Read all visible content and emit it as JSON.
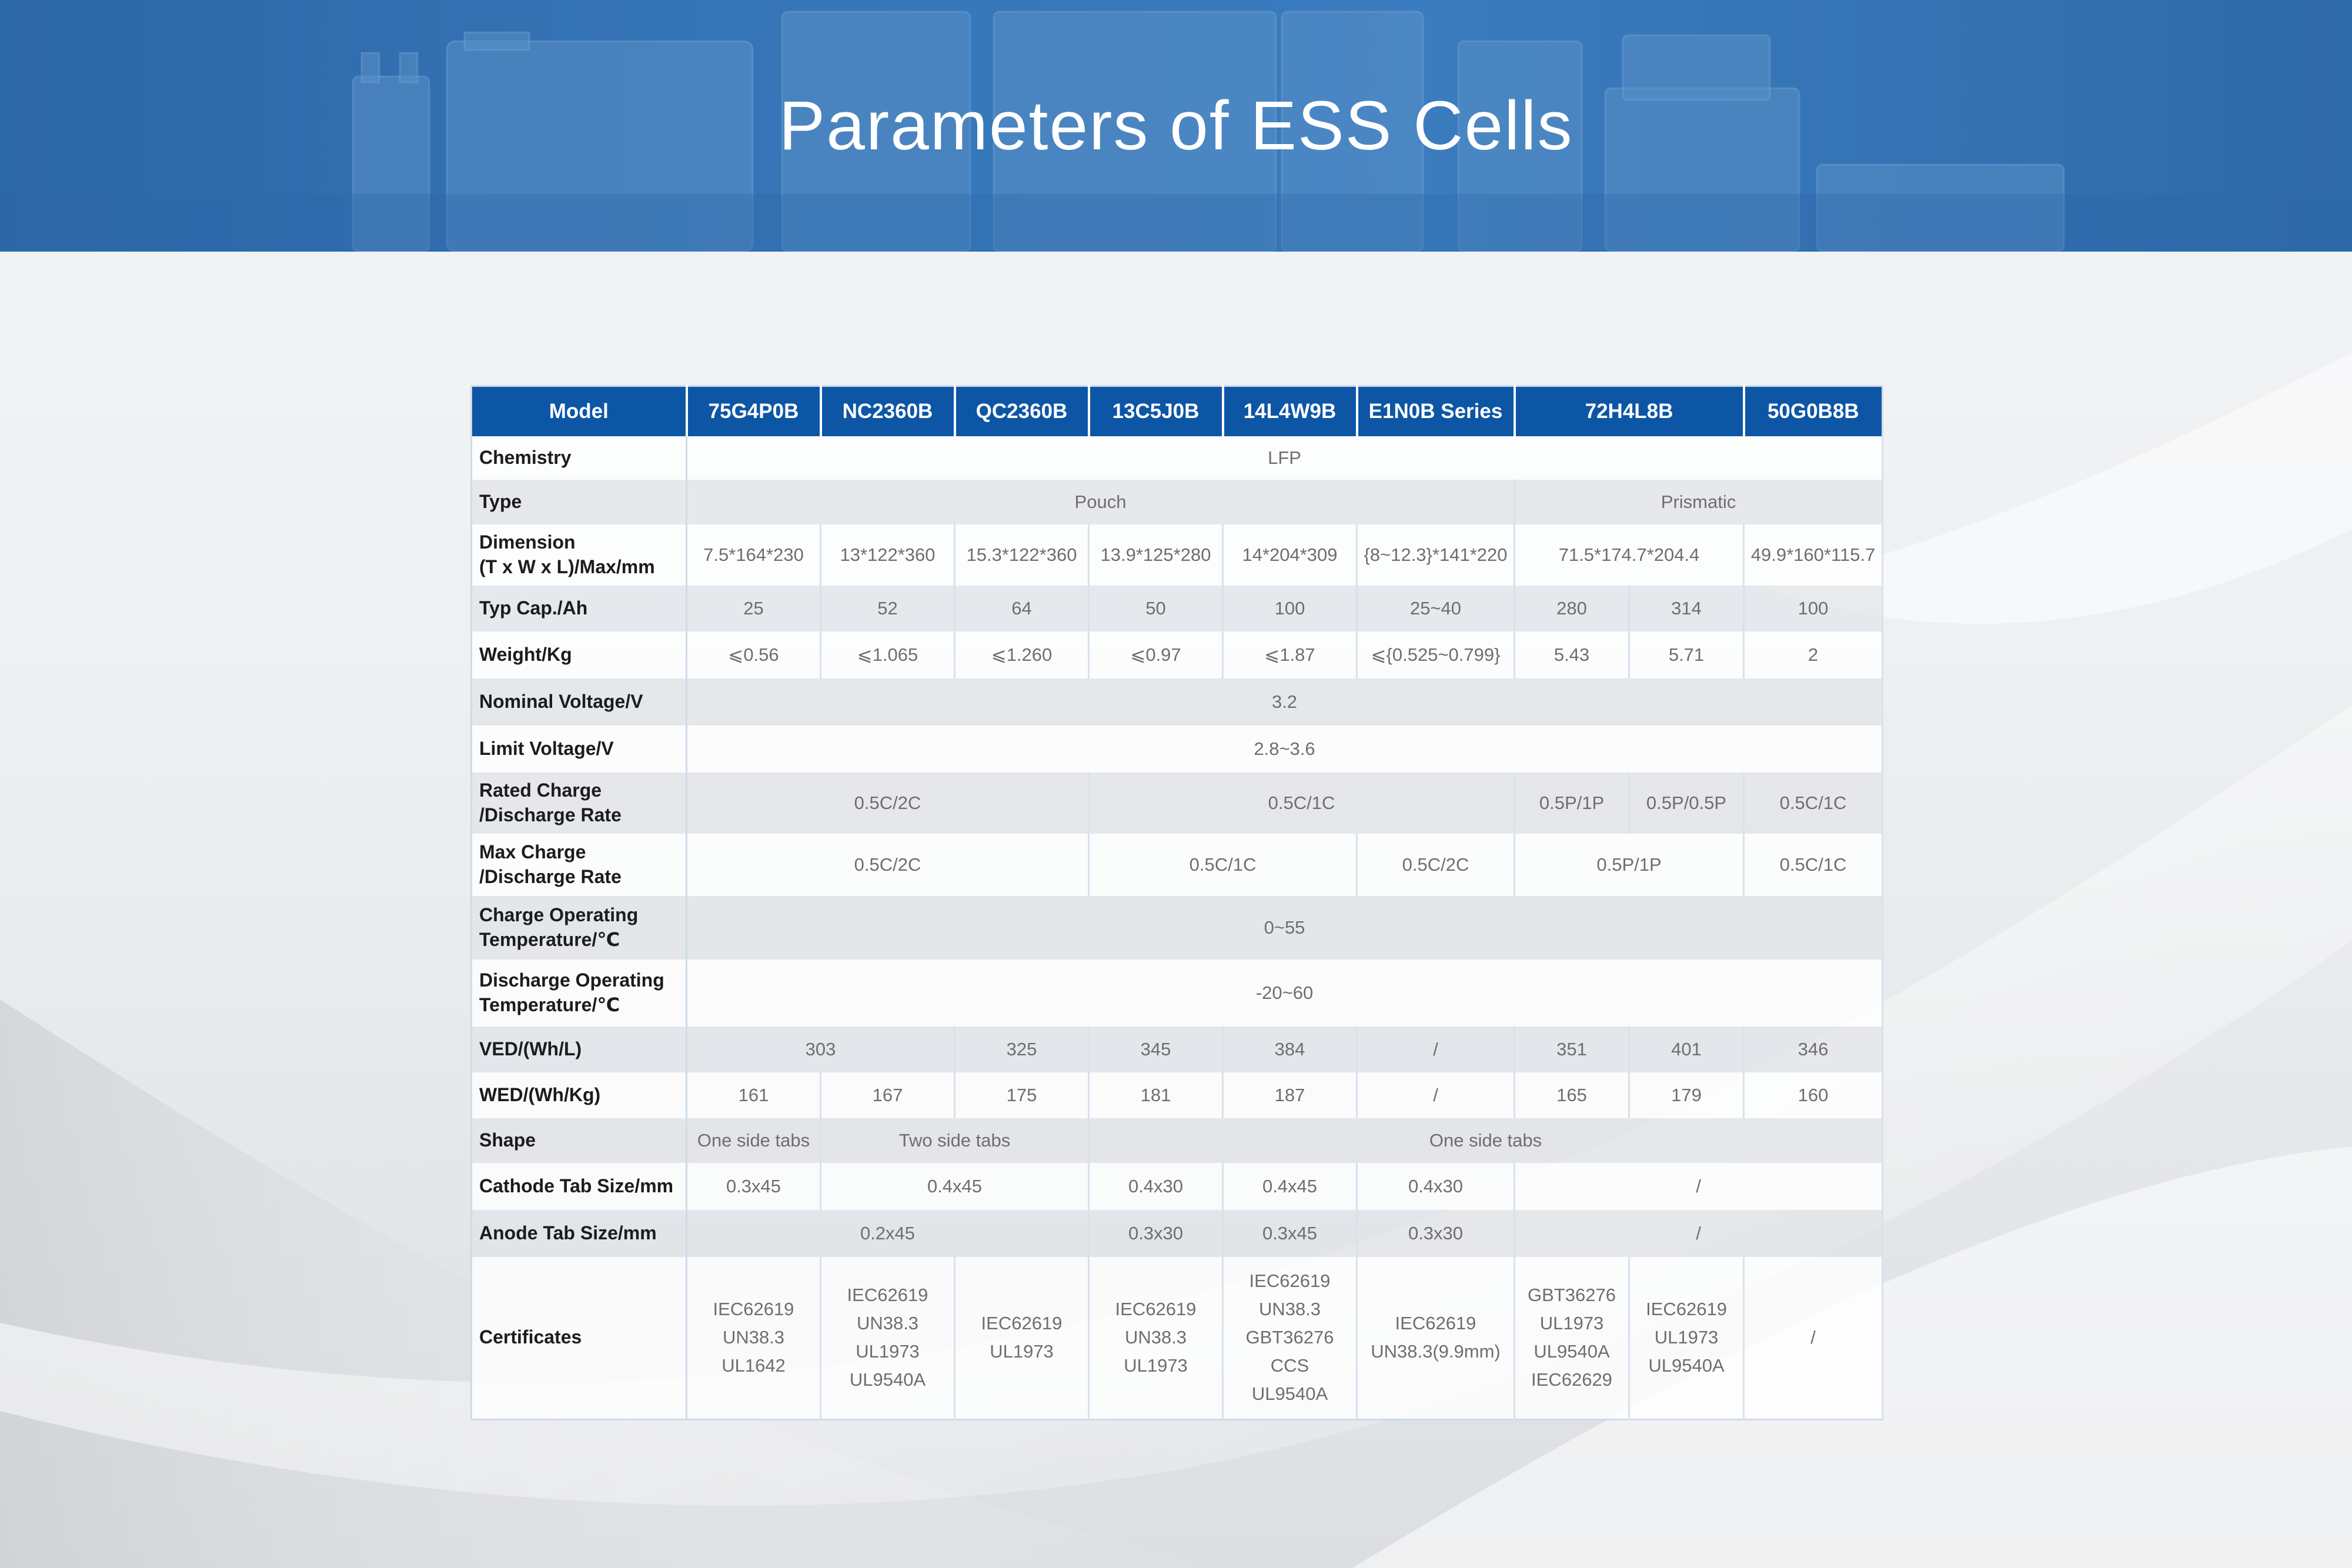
{
  "page": {
    "title": "Parameters of ESS Cells",
    "brand_color": "#0d56a5",
    "banner_color": "#3676b8"
  },
  "table": {
    "header": {
      "model": "Model",
      "m1": "75G4P0B",
      "m2": "NC2360B",
      "m3": "QC2360B",
      "m4": "13C5J0B",
      "m5": "14L4W9B",
      "m6": "E1N0B Series",
      "m7": "72H4L8B",
      "m8": "50G0B8B"
    },
    "chemistry": {
      "label": "Chemistry",
      "value": "LFP"
    },
    "type": {
      "label": "Type",
      "pouch": "Pouch",
      "prismatic": "Prismatic"
    },
    "dimension": {
      "label_1": "Dimension",
      "label_2": "(T x W x L)/Max/mm",
      "v1": "7.5*164*230",
      "v2": "13*122*360",
      "v3": "15.3*122*360",
      "v4": "13.9*125*280",
      "v5": "14*204*309",
      "v6": "{8~12.3}*141*220",
      "v7": "71.5*174.7*204.4",
      "v8": "49.9*160*115.7"
    },
    "capacity": {
      "label": "Typ Cap./Ah",
      "v1": "25",
      "v2": "52",
      "v3": "64",
      "v4": "50",
      "v5": "100",
      "v6": "25~40",
      "v7a": "280",
      "v7b": "314",
      "v8": "100"
    },
    "weight": {
      "label": "Weight/Kg",
      "v1": "⩽0.56",
      "v2": "⩽1.065",
      "v3": "⩽1.260",
      "v4": "⩽0.97",
      "v5": "⩽1.87",
      "v6": "⩽{0.525~0.799}",
      "v7a": "5.43",
      "v7b": "5.71",
      "v8": "2"
    },
    "nominal_voltage": {
      "label": "Nominal Voltage/V",
      "value": "3.2"
    },
    "limit_voltage": {
      "label": "Limit Voltage/V",
      "value": "2.8~3.6"
    },
    "rated_rate": {
      "label_1": "Rated Charge",
      "label_2": "/Discharge Rate",
      "a": "0.5C/2C",
      "b": "0.5C/1C",
      "c": "0.5P/1P",
      "d": "0.5P/0.5P",
      "e": "0.5C/1C"
    },
    "max_rate": {
      "label_1": "Max Charge",
      "label_2": "/Discharge Rate",
      "a": "0.5C/2C",
      "b": "0.5C/1C",
      "c": "0.5C/2C",
      "d": "0.5P/1P",
      "e": "0.5C/1C"
    },
    "charge_temp": {
      "label_1": "Charge Operating",
      "label_2": "Temperature/℃",
      "value": "0~55"
    },
    "discharge_temp": {
      "label_1": "Discharge Operating",
      "label_2": "Temperature/℃",
      "value": "-20~60"
    },
    "ved": {
      "label": "VED/(Wh/L)",
      "v12": "303",
      "v3": "325",
      "v4": "345",
      "v5": "384",
      "v6": "/",
      "v7a": "351",
      "v7b": "401",
      "v8": "346"
    },
    "wed": {
      "label": "WED/(Wh/Kg)",
      "v1": "161",
      "v2": "167",
      "v3": "175",
      "v4": "181",
      "v5": "187",
      "v6": "/",
      "v7a": "165",
      "v7b": "179",
      "v8": "160"
    },
    "shape": {
      "label": "Shape",
      "a": "One side tabs",
      "b": "Two side tabs",
      "c": "One side tabs"
    },
    "cathode": {
      "label": "Cathode Tab Size/mm",
      "v1": "0.3x45",
      "v23": "0.4x45",
      "v4": "0.4x30",
      "v5": "0.4x45",
      "v6": "0.4x30",
      "v78": "/"
    },
    "anode": {
      "label": "Anode Tab Size/mm",
      "v123": "0.2x45",
      "v4": "0.3x30",
      "v5": "0.3x45",
      "v6": "0.3x30",
      "v78": "/"
    },
    "certificates": {
      "label": "Certificates",
      "c1": [
        "IEC62619",
        "UN38.3",
        "UL1642"
      ],
      "c2": [
        "IEC62619",
        "UN38.3",
        "UL1973",
        "UL9540A"
      ],
      "c3": [
        "IEC62619",
        "UL1973"
      ],
      "c4": [
        "IEC62619",
        "UN38.3",
        "UL1973"
      ],
      "c5": [
        "IEC62619",
        "UN38.3",
        "GBT36276",
        "CCS",
        "UL9540A"
      ],
      "c6": [
        "IEC62619",
        "UN38.3(9.9mm)"
      ],
      "c7a": [
        "GBT36276",
        "UL1973",
        "UL9540A",
        "IEC62629"
      ],
      "c7b": [
        "IEC62619",
        "UL1973",
        "UL9540A"
      ],
      "c8": "/"
    }
  }
}
